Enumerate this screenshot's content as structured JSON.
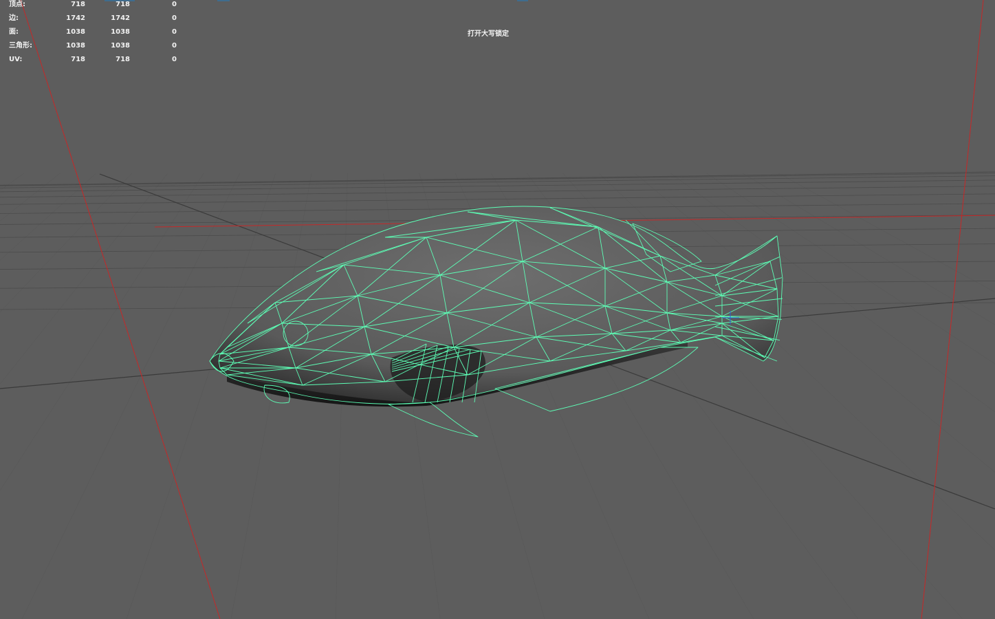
{
  "hud": {
    "rows": [
      {
        "label": "顶点:",
        "v1": "718",
        "v2": "718",
        "v3": "0"
      },
      {
        "label": "边:",
        "v1": "1742",
        "v2": "1742",
        "v3": "0"
      },
      {
        "label": "面:",
        "v1": "1038",
        "v2": "1038",
        "v3": "0"
      },
      {
        "label": "三角形:",
        "v1": "1038",
        "v2": "1038",
        "v3": "0"
      },
      {
        "label": "UV:",
        "v1": "718",
        "v2": "718",
        "v3": "0"
      }
    ]
  },
  "viewport": {
    "message": "打开大写锁定"
  },
  "colors": {
    "background": "#5d5d5d",
    "grid": "#4b4b4b",
    "grid_axis": "#3a3a3a",
    "axis_red": "#c62828",
    "wireframe": "#5dffb6",
    "hud_text": "#f2f2f2"
  },
  "icons": {
    "pivot": "pivot-icon"
  }
}
